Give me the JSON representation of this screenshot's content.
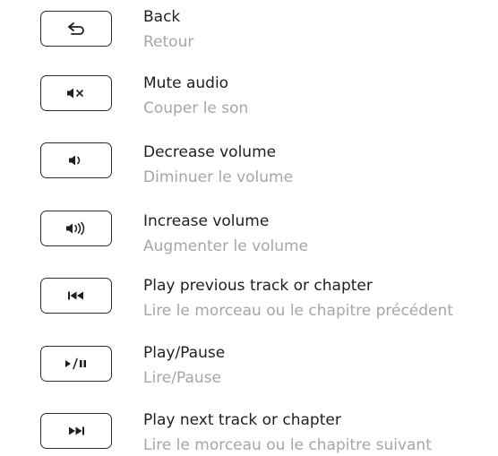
{
  "keys": [
    {
      "icon": "back-arrow-icon",
      "label_en": "Back",
      "label_fr": "Retour"
    },
    {
      "icon": "mute-audio-icon",
      "label_en": "Mute audio",
      "label_fr": "Couper le son"
    },
    {
      "icon": "volume-down-icon",
      "label_en": "Decrease volume",
      "label_fr": "Diminuer le volume"
    },
    {
      "icon": "volume-up-icon",
      "label_en": "Increase volume",
      "label_fr": "Augmenter le volume"
    },
    {
      "icon": "previous-track-icon",
      "label_en": "Play previous track or chapter",
      "label_fr": "Lire le morceau ou le chapitre précédent"
    },
    {
      "icon": "play-pause-icon",
      "label_en": "Play/Pause",
      "label_fr": "Lire/Pause"
    },
    {
      "icon": "next-track-icon",
      "label_en": "Play next track or chapter",
      "label_fr": "Lire le morceau ou le chapitre suivant"
    }
  ]
}
